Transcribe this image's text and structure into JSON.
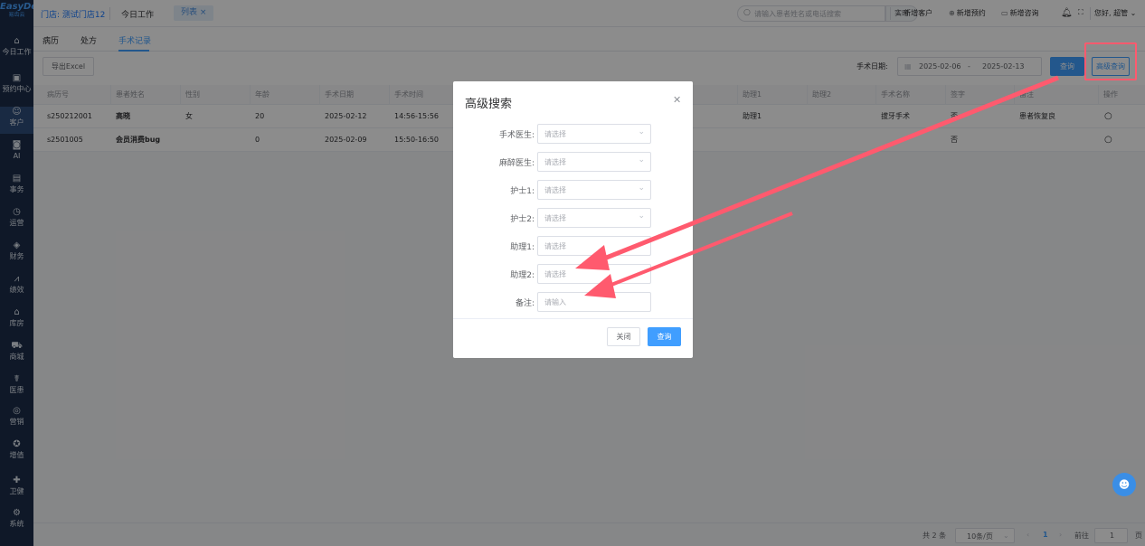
{
  "logo": {
    "name": "EasyDent",
    "sub": "易齿云"
  },
  "sidebar": {
    "items": [
      {
        "label": "今日工作",
        "icon": "home-icon",
        "glyph": "⌂"
      },
      {
        "label": "预约中心",
        "icon": "calendar-icon",
        "glyph": "▣"
      },
      {
        "label": "客户",
        "icon": "user-icon",
        "glyph": "☺"
      },
      {
        "label": "AI",
        "icon": "ai-icon",
        "glyph": "◙"
      },
      {
        "label": "事务",
        "icon": "task-icon",
        "glyph": "▤"
      },
      {
        "label": "运营",
        "icon": "clock-icon",
        "glyph": "◷"
      },
      {
        "label": "财务",
        "icon": "money-icon",
        "glyph": "◈"
      },
      {
        "label": "绩效",
        "icon": "chart-icon",
        "glyph": "⩘"
      },
      {
        "label": "库房",
        "icon": "warehouse-icon",
        "glyph": "⌂"
      },
      {
        "label": "商城",
        "icon": "cart-icon",
        "glyph": "⛟"
      },
      {
        "label": "医患",
        "icon": "doctor-icon",
        "glyph": "☤"
      },
      {
        "label": "营销",
        "icon": "marketing-icon",
        "glyph": "◎"
      },
      {
        "label": "增值",
        "icon": "value-icon",
        "glyph": "✪"
      },
      {
        "label": "卫健",
        "icon": "health-icon",
        "glyph": "✚"
      },
      {
        "label": "系统",
        "icon": "gear-icon",
        "glyph": "⚙"
      }
    ]
  },
  "topbar": {
    "store": "门店: 测试门店12",
    "tab_today": "今日工作",
    "tab_list": "列表 ×",
    "search_placeholder": "请输入患者姓名或电话搜索",
    "realtime": "实时",
    "new_customer": "新增客户",
    "new_appointment": "新增预约",
    "new_consult": "新增咨询",
    "greeting": "您好, 超管"
  },
  "subtabs": [
    "病历",
    "处方",
    "手术记录"
  ],
  "toolbar": {
    "export": "导出Excel",
    "date_label": "手术日期:",
    "date_start": "2025-02-06",
    "date_sep": "-",
    "date_end": "2025-02-13",
    "query": "查询",
    "advanced": "高级查询"
  },
  "table": {
    "headers": [
      "病历号",
      "患者姓名",
      "性别",
      "年龄",
      "手术日期",
      "手术时间",
      "助理1",
      "助理2",
      "手术名称",
      "签字",
      "备注",
      "操作"
    ],
    "rows": [
      {
        "id": "s250212001",
        "name": "高晓",
        "gender": "女",
        "age": "20",
        "date": "2025-02-12",
        "time": "14:56-15:56",
        "asst1": "助理1",
        "asst2": "",
        "surgery": "拔牙手术",
        "signed": "否",
        "note": "患者恢复良"
      },
      {
        "id": "s2501005",
        "name": "会员消费bug",
        "gender": "",
        "age": "0",
        "date": "2025-02-09",
        "time": "15:50-16:50",
        "asst1": "",
        "asst2": "",
        "surgery": "",
        "signed": "否",
        "note": ""
      }
    ]
  },
  "pager": {
    "total": "共 2 条",
    "size": "10条/页",
    "page": "1",
    "goto": "前往",
    "goto_value": "1",
    "unit": "页"
  },
  "modal": {
    "title": "高级搜索",
    "fields": [
      {
        "label": "手术医生:",
        "placeholder": "请选择",
        "type": "select"
      },
      {
        "label": "麻醉医生:",
        "placeholder": "请选择",
        "type": "select"
      },
      {
        "label": "护士1:",
        "placeholder": "请选择",
        "type": "select"
      },
      {
        "label": "护士2:",
        "placeholder": "请选择",
        "type": "select"
      },
      {
        "label": "助理1:",
        "placeholder": "请选择",
        "type": "select"
      },
      {
        "label": "助理2:",
        "placeholder": "请选择",
        "type": "select"
      },
      {
        "label": "备注:",
        "placeholder": "请输入",
        "type": "input"
      }
    ],
    "close": "关闭",
    "search": "查询"
  },
  "colors": {
    "primary": "#409eff",
    "sidebar": "#1c2d4a",
    "annotation": "#ff5a6e"
  }
}
